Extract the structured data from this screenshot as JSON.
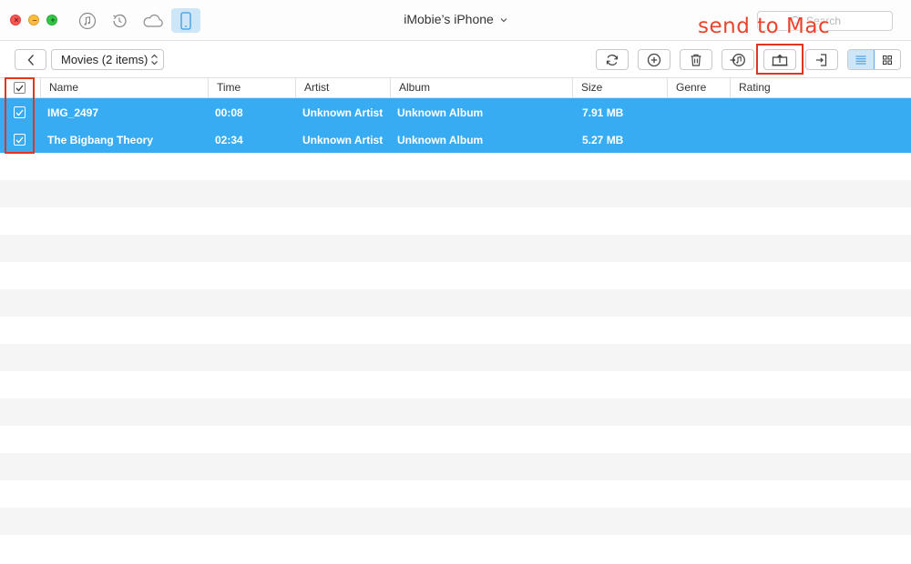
{
  "window": {
    "device_title": "iMobie’s iPhone",
    "search_placeholder": "Search"
  },
  "toolbar": {
    "category_label": "Movies (2 items)"
  },
  "annotation": {
    "text": "send to Mac",
    "color": "#e8432c"
  },
  "table": {
    "columns": [
      "Name",
      "Time",
      "Artist",
      "Album",
      "Size",
      "Genre",
      "Rating"
    ],
    "rows": [
      {
        "name": "IMG_2497",
        "time": "00:08",
        "artist": "Unknown Artist",
        "album": "Unknown Album",
        "size": "7.91 MB",
        "genre": "",
        "rating": "",
        "checked": true
      },
      {
        "name": "The Bigbang Theory",
        "time": "02:34",
        "artist": "Unknown Artist",
        "album": "Unknown Album",
        "size": "5.27 MB",
        "genre": "",
        "rating": "",
        "checked": true
      }
    ],
    "select_all": true
  },
  "colors": {
    "selection": "#38acf3",
    "accent_active": "#cde6f8",
    "highlight": "#e3341f"
  },
  "icons": {
    "nav": [
      "music-note-icon",
      "history-icon",
      "cloud-icon",
      "phone-icon"
    ],
    "toolbar": [
      "refresh-icon",
      "add-icon",
      "trash-icon",
      "to-itunes-icon",
      "send-to-mac-icon",
      "to-device-icon",
      "list-view-icon",
      "grid-view-icon"
    ]
  }
}
